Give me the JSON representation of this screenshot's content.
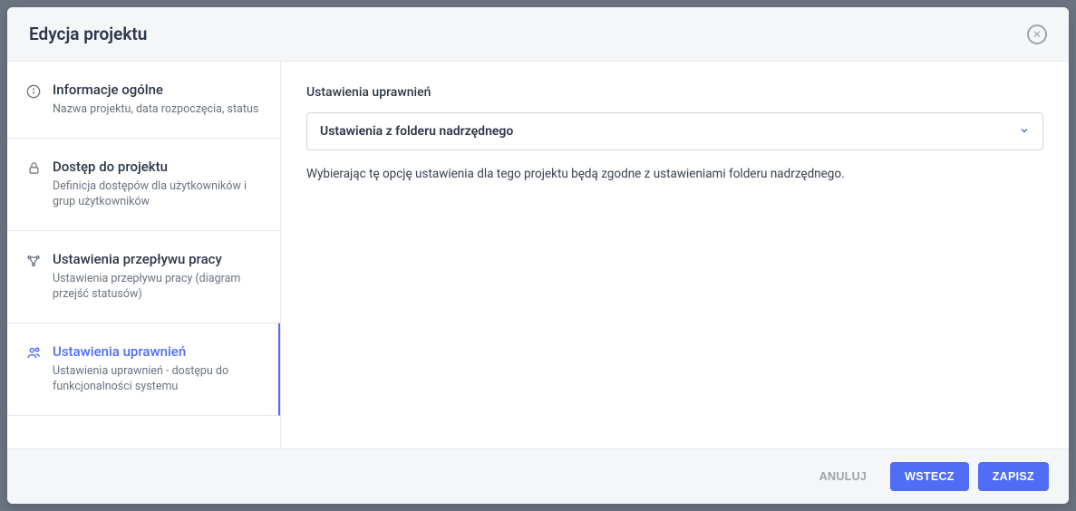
{
  "modal": {
    "title": "Edycja projektu"
  },
  "sidebar": {
    "items": [
      {
        "title": "Informacje ogólne",
        "desc": "Nazwa projektu, data rozpoczęcia, status"
      },
      {
        "title": "Dostęp do projektu",
        "desc": "Definicja dostępów dla użytkowników i grup użytkowników"
      },
      {
        "title": "Ustawienia przepływu pracy",
        "desc": "Ustawienia przepływu pracy (diagram przejść statusów)"
      },
      {
        "title": "Ustawienia uprawnień",
        "desc": "Ustawienia uprawnień - dostępu do funkcjonalności systemu"
      }
    ]
  },
  "content": {
    "heading": "Ustawienia uprawnień",
    "select_value": "Ustawienia z folderu nadrzędnego",
    "help_text": "Wybierając tę opcję ustawienia dla tego projektu będą zgodne z ustawieniami folderu nadrzędnego."
  },
  "footer": {
    "cancel": "ANULUJ",
    "back": "WSTECZ",
    "save": "ZAPISZ"
  }
}
